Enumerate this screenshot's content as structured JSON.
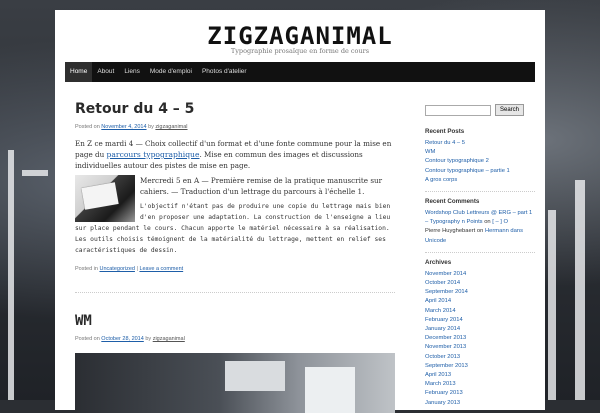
{
  "site": {
    "title": "ZIGZAGANIMAL",
    "tagline": "Typographie prosaïque en forme de cours"
  },
  "nav": {
    "items": [
      "Home",
      "About",
      "Liens",
      "Mode d'emploi",
      "Photos d'atelier"
    ]
  },
  "post1": {
    "title": "Retour du 4 – 5",
    "meta_prefix": "Posted on ",
    "meta_date": "November 4, 2014",
    "meta_mid": " by ",
    "meta_author": "zigzaganimal",
    "p1_a": "En Z ce mardi 4 — Choix collectif d'un format et d'une fonte commune pour la mise en page du ",
    "p1_link": "parcours typographique",
    "p1_b": ". Mise en commun des images et discussions individuelles autour des pistes de mise en page.",
    "p2": "Mercredi 5 en A — Première remise de la pratique manuscrite sur cahiers. — Traduction d'un lettrage du parcours à l'échelle 1.",
    "p3": "L'objectif n'étant pas de produire une copie du lettrage mais bien d'en proposer une adaptation. La construction de l'enseigne a lieu sur place pendant le cours. Chacun apporte le matériel nécessaire à sa réalisation. Les outils choisis témoignent de la matérialité du lettrage, mettent en relief ses caractéristiques de dessin.",
    "foot_prefix": "Posted in ",
    "foot_cat": "Uncategorized",
    "foot_sep": " | ",
    "foot_comment": "Leave a comment"
  },
  "post2": {
    "title": "WM",
    "meta_prefix": "Posted on ",
    "meta_date": "October 28, 2014",
    "meta_mid": " by ",
    "meta_author": "zigzaganimal"
  },
  "sidebar": {
    "search_placeholder": "",
    "search_button": "Search",
    "recent_posts_title": "Recent Posts",
    "recent_posts": [
      "Retour du 4 – 5",
      "WM",
      "Contour typographique 2",
      "Contour typographique – partie 1",
      "A gros corps"
    ],
    "recent_comments_title": "Recent Comments",
    "rc1_author": "Wordshop Club Lettreurs @ ERG – part 1 – Typography n Points",
    "rc1_on": " on ",
    "rc1_post": "[ – ] O",
    "rc2_author": "Pierre Huyghebaert",
    "rc2_on": " on ",
    "rc2_post": "Hermann dans Unicode",
    "archives_title": "Archives",
    "archives": [
      "November 2014",
      "October 2014",
      "September 2014",
      "April 2014",
      "March 2014",
      "February 2014",
      "January 2014",
      "December 2013",
      "November 2013",
      "October 2013",
      "September 2013",
      "April 2013",
      "March 2013",
      "February 2013",
      "January 2013"
    ]
  }
}
